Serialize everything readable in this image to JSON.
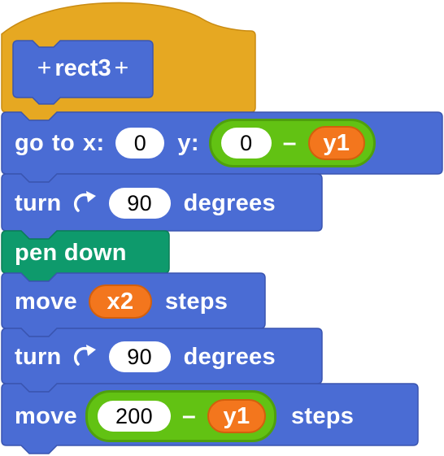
{
  "colors": {
    "motion": "#4a6cd4",
    "motion_dark": "#3a55b0",
    "pen": "#0e9a6c",
    "control_hat": "#e6a822",
    "variable": "#f3761d",
    "operator": "#62c213"
  },
  "define_block": {
    "plus_left": "+",
    "name": "rect3",
    "plus_right": "+"
  },
  "go_to": {
    "label_go": "go",
    "label_to": "to",
    "label_x": "x:",
    "x_value": "0",
    "label_y": "y:",
    "y_operator": {
      "left_value": "0",
      "operator": "–",
      "right_variable": "y1"
    }
  },
  "turn_1": {
    "label_turn": "turn",
    "icon": "turn-clockwise-icon",
    "degrees_value": "90",
    "label_degrees": "degrees"
  },
  "pen_down": {
    "label": "pen down"
  },
  "move_1": {
    "label_move": "move",
    "steps_variable": "x2",
    "label_steps": "steps"
  },
  "turn_2": {
    "label_turn": "turn",
    "icon": "turn-clockwise-icon",
    "degrees_value": "90",
    "label_degrees": "degrees"
  },
  "move_2": {
    "label_move": "move",
    "steps_operator": {
      "left_value": "200",
      "operator": "–",
      "right_variable": "y1"
    },
    "label_steps": "steps"
  }
}
